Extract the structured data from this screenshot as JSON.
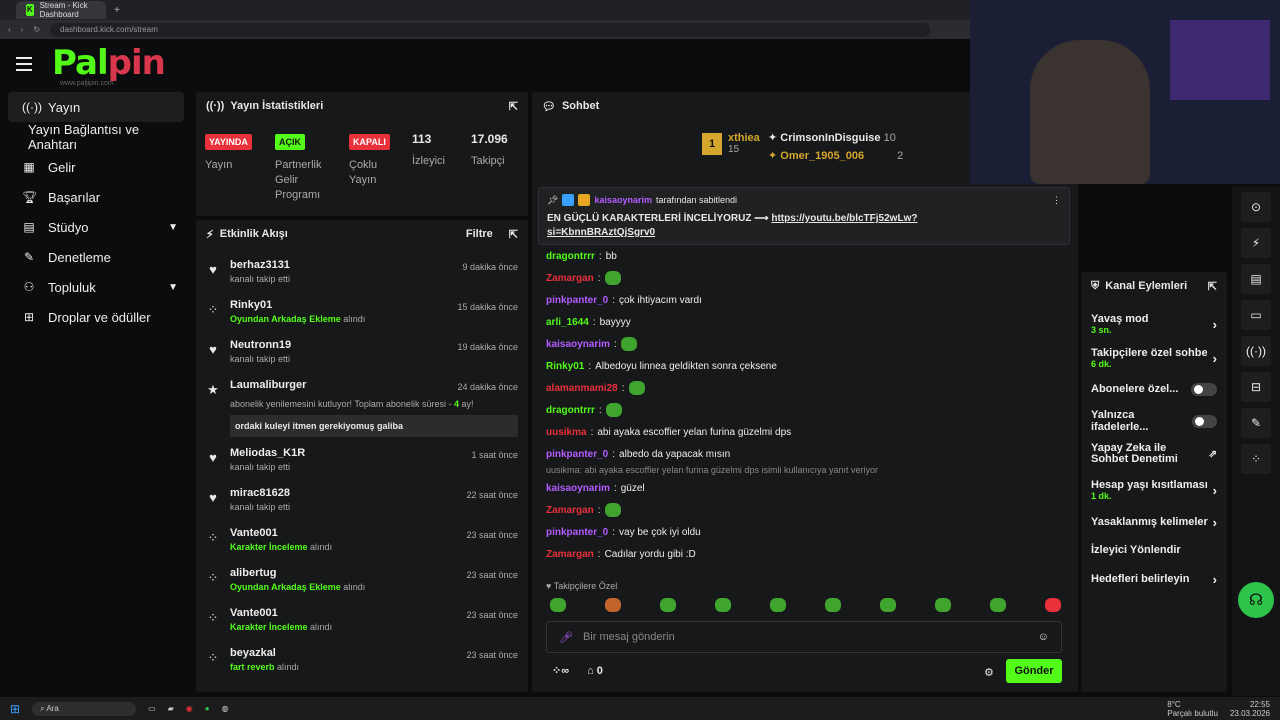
{
  "browser": {
    "tab_title": "Stream - Kick Dashboard",
    "url": "dashboard.kick.com/stream"
  },
  "logo": {
    "text_left": "Pal",
    "text_right": "pin",
    "sub": "www.paljipin.com"
  },
  "sidebar": {
    "items": [
      {
        "label": "Yayın",
        "icon": "broadcast-icon"
      },
      {
        "label": "Yayın Bağlantısı ve Anahtarı",
        "icon": ""
      },
      {
        "label": "Gelir",
        "icon": "chart-icon"
      },
      {
        "label": "Başarılar",
        "icon": "trophy-icon"
      },
      {
        "label": "Stüdyo",
        "icon": "layout-icon"
      },
      {
        "label": "Denetleme",
        "icon": "wrench-icon"
      },
      {
        "label": "Topluluk",
        "icon": "people-icon"
      },
      {
        "label": "Droplar ve ödüller",
        "icon": "gift-icon"
      }
    ]
  },
  "stats": {
    "title": "Yayın İstatistikleri",
    "badges": [
      {
        "badge": "YAYINDA",
        "label": "Yayın",
        "color": "#e8313a"
      },
      {
        "badge": "AÇIK",
        "label": "Partnerlik Gelir Programı",
        "color": "#53fc18"
      },
      {
        "badge": "KAPALI",
        "label": "Çoklu Yayın",
        "color": "#e8313a"
      }
    ],
    "viewers": {
      "value": "113",
      "label": "İzleyici"
    },
    "followers": {
      "value": "17.096",
      "label": "Takipçi"
    }
  },
  "activity": {
    "title": "Etkinlik Akışı",
    "filter": "Filtre",
    "items": [
      {
        "icon": "heart-icon",
        "name": "berhaz3131",
        "pre": "kanalı takip etti",
        "hl": "",
        "post": "",
        "time": "9 dakika önce"
      },
      {
        "icon": "dots-icon",
        "name": "Rinky01",
        "pre": "",
        "hl": "Oyundan Arkadaş Ekleme",
        "post": " alındı",
        "time": "15 dakika önce"
      },
      {
        "icon": "heart-icon",
        "name": "Neutronn19",
        "pre": "kanalı takip etti",
        "hl": "",
        "post": "",
        "time": "19 dakika önce"
      },
      {
        "icon": "dots-icon",
        "name": "Meliodas_K1R",
        "pre": "kanalı takip etti",
        "hl": "",
        "post": "",
        "time": "1 saat önce"
      },
      {
        "icon": "heart-icon",
        "name": "mirac81628",
        "pre": "kanalı takip etti",
        "hl": "",
        "post": "",
        "time": "22 saat önce"
      },
      {
        "icon": "dots-icon",
        "name": "Vante001",
        "pre": "",
        "hl": "Karakter İnceleme",
        "post": " alındı",
        "time": "23 saat önce"
      },
      {
        "icon": "dots-icon",
        "name": "alibertug",
        "pre": "",
        "hl": "Oyundan Arkadaş Ekleme",
        "post": " alındı",
        "time": "23 saat önce"
      },
      {
        "icon": "dots-icon",
        "name": "Vante001",
        "pre": "",
        "hl": "Karakter İnceleme",
        "post": " alındı",
        "time": "23 saat önce"
      },
      {
        "icon": "dots-icon",
        "name": "beyazkal",
        "pre": "",
        "hl": "fart reverb",
        "post": " alındı",
        "time": "23 saat önce"
      }
    ],
    "sub_item": {
      "name": "Laumaliburger",
      "time": "24 dakika önce",
      "text_pre": "abonelik yenilemesini kutluyor! Toplam abonelik süresi - ",
      "months": "4",
      "text_post": " ay!",
      "message": "ordaki kuleyi itmen gerekiyomuş galiba"
    }
  },
  "chat": {
    "title": "Sohbet",
    "leaders": [
      {
        "rank": "1",
        "name": "xthiea",
        "count": "15"
      },
      {
        "name": "CrimsonInDisguise",
        "count": "10"
      },
      {
        "name": "Omer_1905_006",
        "count": "2"
      }
    ],
    "pinned": {
      "by": "kaisaoynarim",
      "by_suffix": "tarafından sabitlendi",
      "text": "EN GÜÇLÜ KARAKTERLERİ İNCELİYORUZ ⟶",
      "link": "https://youtu.be/blcTFj52wLw?si=KbnnBRAztQjSgrv0"
    },
    "messages": [
      {
        "user": "dragontrrr",
        "color": "#53fc18",
        "text": "bb"
      },
      {
        "user": "Zamargan",
        "color": "#e8313a",
        "text": ""
      },
      {
        "user": "pinkpanter_0",
        "color": "#b45cff",
        "text": "çok ihtiyacım vardı"
      },
      {
        "user": "arli_1644",
        "color": "#53fc18",
        "text": "bayyyy"
      },
      {
        "user": "kaisaoynarim",
        "color": "#b45cff",
        "text": ""
      },
      {
        "user": "Rinky01",
        "color": "#53fc18",
        "text": "Albedoyu linnea geldikten sonra çeksene"
      },
      {
        "user": "alamanmami28",
        "color": "#e8313a",
        "text": ""
      },
      {
        "user": "dragontrrr",
        "color": "#53fc18",
        "text": ""
      },
      {
        "user": "uusikma",
        "color": "#e8313a",
        "text": "abi ayaka escoffier yelan furina güzelmi dps"
      },
      {
        "user": "pinkpanter_0",
        "color": "#b45cff",
        "text": "albedo da yapacak mısın"
      },
      {
        "user": "kaisaoynarim",
        "color": "#b45cff",
        "text": "güzel"
      },
      {
        "user": "Zamargan",
        "color": "#e8313a",
        "text": ""
      },
      {
        "user": "pinkpanter_0",
        "color": "#b45cff",
        "text": "vay be çok iyi oldu"
      },
      {
        "user": "Zamargan",
        "color": "#e8313a",
        "text": "Cadılar yordu gibi :D"
      }
    ],
    "reply_hint": "uusikma: abi ayaka escoffier yelan furina güzelmi dps isimli kullanıcıya yanıt veriyor",
    "followers_only": "Takipçilere Özel",
    "input_placeholder": "Bir mesaj gönderin",
    "points": "0",
    "send": "Gönder"
  },
  "channel_actions": {
    "title": "Kanal Eylemleri",
    "rows": [
      {
        "label": "Yavaş mod",
        "sub": "3 sn.",
        "type": "arrow"
      },
      {
        "label": "Takipçilere özel sohbet",
        "sub": "6 dk.",
        "type": "arrow"
      },
      {
        "label": "Abonelere özel...",
        "sub": "",
        "type": "toggle"
      },
      {
        "label": "Yalnızca ifadelerle...",
        "sub": "",
        "type": "toggle"
      },
      {
        "label": "Yapay Zeka ile Sohbet Denetimi",
        "sub": "",
        "type": "ext"
      },
      {
        "label": "Hesap yaşı kısıtlaması",
        "sub": "1 dk.",
        "type": "arrow"
      },
      {
        "label": "Yasaklanmış kelimeler",
        "sub": "",
        "type": "arrow"
      },
      {
        "label": "İzleyici Yönlendir",
        "sub": "",
        "type": "none"
      },
      {
        "label": "Hedefleri belirleyin",
        "sub": "",
        "type": "arrow"
      }
    ]
  },
  "taskbar": {
    "search": "Ara",
    "weather": "8°C",
    "weather_sub": "Parçalı bulutlu",
    "time": "22:55",
    "date": "23.03.2026"
  }
}
